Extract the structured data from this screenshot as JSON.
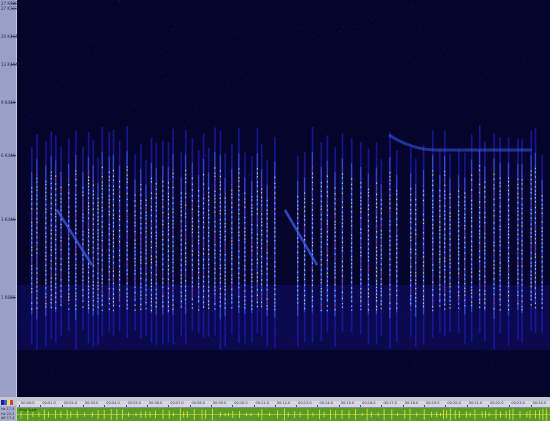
{
  "spectrogram": {
    "background_color": "#05042a",
    "palette": [
      "#1a1aa8",
      "#3a5ae8",
      "#e8e850",
      "#e83a2a"
    ],
    "frequency_labels": [
      "27 K988",
      "27 K333",
      "20 K444",
      "13 K444",
      "9 K444",
      "6 K444",
      "3 K444",
      "1 K666"
    ]
  },
  "time_ruler": {
    "labels": [
      "00:00:0",
      "00:01.0",
      "00:02.0",
      "00:03.0",
      "00:04.0",
      "00:05.0",
      "00:06.0",
      "00:07.0",
      "00:08.0",
      "00:09.0",
      "00:10.0",
      "00:11.0",
      "00:12.0",
      "00:13.0",
      "00:14.0",
      "00:15.0",
      "00:16.0",
      "00:17.0",
      "00:18.0",
      "00:19.0",
      "00:20.0",
      "00:21.0",
      "00:22.0",
      "00:23.0",
      "00:24.0"
    ]
  },
  "waveform": {
    "label": "Amplitude",
    "background_color": "#5a9a26",
    "line_color": "#e8e83a"
  },
  "side_info": {
    "lines": [
      "Hz 17.4",
      "Hz 22:2",
      "dB 17.4"
    ]
  }
}
